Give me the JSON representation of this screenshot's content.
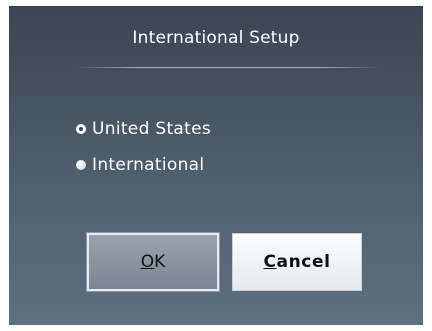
{
  "dialog": {
    "title": "International Setup"
  },
  "options": [
    {
      "label": "United States",
      "selected": true
    },
    {
      "label": "International",
      "selected": false
    }
  ],
  "buttons": {
    "ok": {
      "mnemonic": "O",
      "rest": "K"
    },
    "cancel": {
      "mnemonic": "C",
      "rest": "ancel"
    }
  },
  "colors": {
    "background_top": "#3a4550",
    "background_bottom": "#5f7080",
    "text": "#ffffff"
  }
}
